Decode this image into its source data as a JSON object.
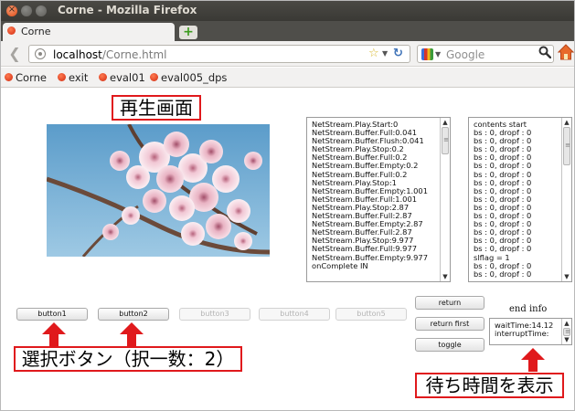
{
  "window": {
    "title": "Corne - Mozilla Firefox"
  },
  "tab": {
    "label": "Corne"
  },
  "nav": {
    "url_host": "localhost",
    "url_path": "/Corne.html",
    "search_placeholder": "Google"
  },
  "bookmarks": [
    "Corne",
    "exit",
    "eval01",
    "eval005_dps"
  ],
  "annotations": {
    "playback_screen": "再生画面",
    "select_buttons": "選択ボタン（択一数：2）",
    "show_wait_time": "待ち時間を表示"
  },
  "colors": {
    "annotation_red": "#e0191c",
    "favicon_red": "#d12a10"
  },
  "netstream_log": [
    "NetStream.Play.Start:0",
    "NetStream.Buffer.Full:0.041",
    "NetStream.Buffer.Flush:0.041",
    "NetStream.Play.Stop:0.2",
    "NetStream.Buffer.Full:0.2",
    "NetStream.Buffer.Empty:0.2",
    "NetStream.Buffer.Full:0.2",
    "NetStream.Play.Stop:1",
    "NetStream.Buffer.Empty:1.001",
    "NetStream.Buffer.Full:1.001",
    "NetStream.Play.Stop:2.87",
    "NetStream.Buffer.Full:2.87",
    "NetStream.Buffer.Empty:2.87",
    "NetStream.Buffer.Full:2.87",
    "NetStream.Play.Stop:9.977",
    "NetStream.Buffer.Full:9.977",
    "NetStream.Buffer.Empty:9.977",
    "onComplete IN"
  ],
  "contents_log": [
    "contents start",
    "bs : 0, dropf : 0",
    "bs : 0, dropf : 0",
    "bs : 0, dropf : 0",
    "bs : 0, dropf : 0",
    "bs : 0, dropf : 0",
    "bs : 0, dropf : 0",
    "bs : 0, dropf : 0",
    "bs : 0, dropf : 0",
    "bs : 0, dropf : 0",
    "bs : 0, dropf : 0",
    "bs : 0, dropf : 0",
    "bs : 0, dropf : 0",
    "bs : 0, dropf : 0",
    "bs : 0, dropf : 0",
    "bs : 0, dropf : 0",
    "slflag = 1",
    "bs : 0, dropf : 0",
    "bs : 0, dropf : 0"
  ],
  "buttons": {
    "button1": "button1",
    "button2": "button2",
    "button3": "button3",
    "button4": "button4",
    "button5": "button5",
    "return": "return",
    "return_first": "return first",
    "toggle": "toggle"
  },
  "end_info": {
    "label": "end info",
    "lines": [
      "waitTime:14.12",
      "interruptTime:"
    ]
  }
}
